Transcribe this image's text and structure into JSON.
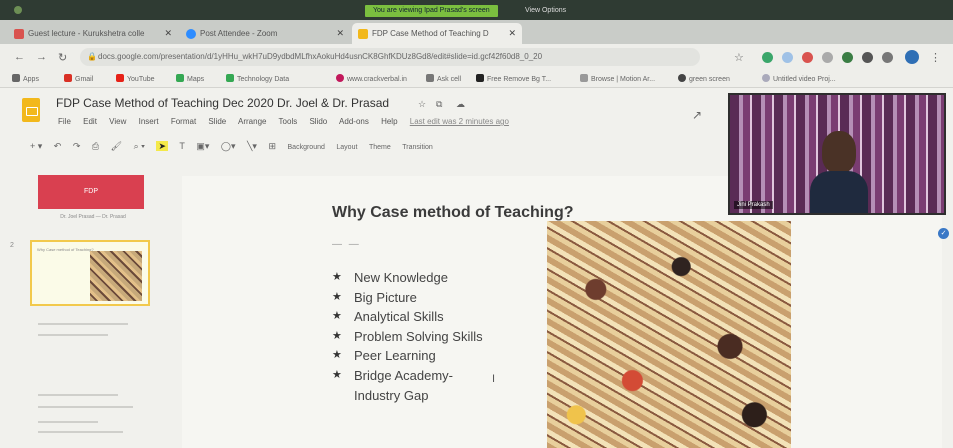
{
  "window": {
    "share_banner": "You are viewing Ipad Prasad's screen",
    "view_options": "View Options"
  },
  "tabs": [
    {
      "label": "Guest lecture - Kurukshetra colle",
      "color": "#d9534f"
    },
    {
      "label": "Post Attendee - Zoom",
      "color": "#2d8cff"
    },
    {
      "label": "FDP Case Method of Teaching D",
      "color": "#f2b81b"
    }
  ],
  "address_bar": {
    "url": "docs.google.com/presentation/d/1yHHu_wkH7uD9ydbdMLfhxAokuHd4usnCK8GhfKDUz8Gd8/edit#slide=id.gcf42f60d8_0_20"
  },
  "bookmarks": [
    {
      "label": "Apps",
      "color": "#666"
    },
    {
      "label": "Gmail",
      "color": "#d93025"
    },
    {
      "label": "YouTube",
      "color": "#e62117"
    },
    {
      "label": "Maps",
      "color": "#34a853"
    },
    {
      "label": "Technology Data",
      "color": "#34a853"
    },
    {
      "label": "www.crackverbal.in",
      "color": "#c2185b"
    },
    {
      "label": "Ask cell",
      "color": "#777"
    },
    {
      "label": "Free Remove Bg T...",
      "color": "#222"
    },
    {
      "label": "Browse | Motion Ar...",
      "color": "#999"
    },
    {
      "label": "green screen",
      "color": "#444"
    },
    {
      "label": "Untitled video Proj...",
      "color": "#aab"
    }
  ],
  "slides_app": {
    "title": "FDP Case Method of Teaching Dec 2020  Dr. Joel & Dr. Prasad",
    "menu": [
      "File",
      "Edit",
      "View",
      "Insert",
      "Format",
      "Slide",
      "Arrange",
      "Tools",
      "Slido",
      "Add-ons",
      "Help"
    ],
    "last_edit": "Last edit was 2 minutes ago",
    "toolbar_text_buttons": [
      "Background",
      "Layout",
      "Theme",
      "Transition"
    ],
    "zoom_label": "",
    "thumbnail_1": {
      "label": "FDP",
      "caption": "Dr. Joel Prasad — Dr. Prasad"
    },
    "thumbnail_2": {
      "number": "2",
      "mini_title": "Why Case method of Teaching?"
    }
  },
  "slide": {
    "title": "Why Case method of Teaching?",
    "bullets": [
      "New Knowledge",
      "Big Picture",
      "Analytical Skills",
      "Problem Solving Skills",
      "Peer Learning",
      "Bridge Academy-",
      "Industry Gap"
    ]
  },
  "video": {
    "participant_name": "Jini Prakash"
  }
}
